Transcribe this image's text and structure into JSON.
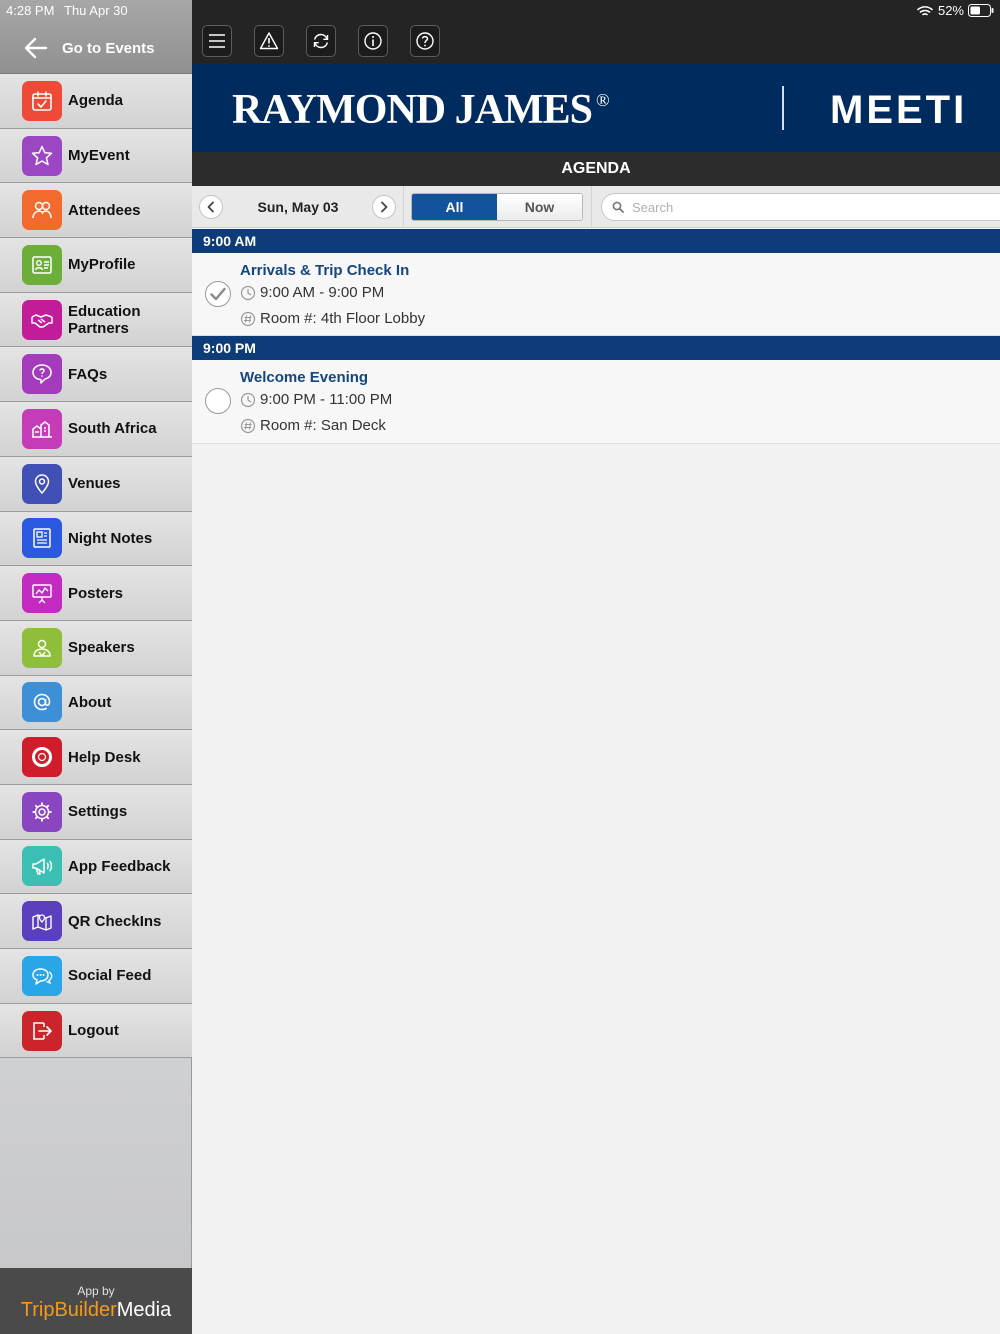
{
  "status": {
    "time": "4:28 PM",
    "date": "Thu Apr 30",
    "battery": "52%"
  },
  "sidebar": {
    "back_label": "Go to Events",
    "items": [
      {
        "label": "Agenda",
        "icon": "calendar-check-icon",
        "color": "#ef4a38"
      },
      {
        "label": "MyEvent",
        "icon": "star-icon",
        "color": "#9b47c4"
      },
      {
        "label": "Attendees",
        "icon": "people-icon",
        "color": "#f26a2e"
      },
      {
        "label": "MyProfile",
        "icon": "profile-card-icon",
        "color": "#6cae3a"
      },
      {
        "label": "Education Partners",
        "icon": "handshake-icon",
        "color": "#c21c9a"
      },
      {
        "label": "FAQs",
        "icon": "speech-bubble-question-icon",
        "color": "#a43bbd"
      },
      {
        "label": "South Africa",
        "icon": "city-icon",
        "color": "#c53cb9"
      },
      {
        "label": "Venues",
        "icon": "map-pin-icon",
        "color": "#4050b5"
      },
      {
        "label": "Night Notes",
        "icon": "newspaper-icon",
        "color": "#2a58e0"
      },
      {
        "label": "Posters",
        "icon": "easel-chart-icon",
        "color": "#c32bc0"
      },
      {
        "label": "Speakers",
        "icon": "speaker-person-icon",
        "color": "#8fbe3b"
      },
      {
        "label": "About",
        "icon": "at-sign-icon",
        "color": "#3d8fd8"
      },
      {
        "label": "Help Desk",
        "icon": "lifebuoy-icon",
        "color": "#d01d2b"
      },
      {
        "label": "Settings",
        "icon": "gear-icon",
        "color": "#8a45c0"
      },
      {
        "label": "App Feedback",
        "icon": "megaphone-icon",
        "color": "#3bbfb3"
      },
      {
        "label": "QR CheckIns",
        "icon": "map-pin-icon",
        "color": "#5a3fbe"
      },
      {
        "label": "Social Feed",
        "icon": "chat-bubbles-icon",
        "color": "#29a6e8"
      },
      {
        "label": "Logout",
        "icon": "logout-icon",
        "color": "#c9252a"
      }
    ],
    "footer": {
      "by": "App by",
      "brand_part1": "TripBuilder",
      "brand_part2": "Media"
    }
  },
  "toolbar": {
    "icons": [
      "menu-icon",
      "alert-icon",
      "refresh-icon",
      "info-icon",
      "help-icon"
    ]
  },
  "banner": {
    "brand": "RAYMOND JAMES",
    "reg": "®",
    "title": "MEETI"
  },
  "section_title": "AGENDA",
  "filter": {
    "date": "Sun, May 03",
    "seg_all": "All",
    "seg_now": "Now",
    "search_placeholder": "Search"
  },
  "agenda": [
    {
      "time_header": "9:00 AM",
      "title": "Arrivals & Trip Check In",
      "time": "9:00 AM - 9:00 PM",
      "room": "Room #: 4th Floor Lobby",
      "checked": true
    },
    {
      "time_header": "9:00 PM",
      "title": "Welcome Evening",
      "time": "9:00 PM - 11:00 PM",
      "room": "Room #: San Deck",
      "checked": false
    }
  ]
}
